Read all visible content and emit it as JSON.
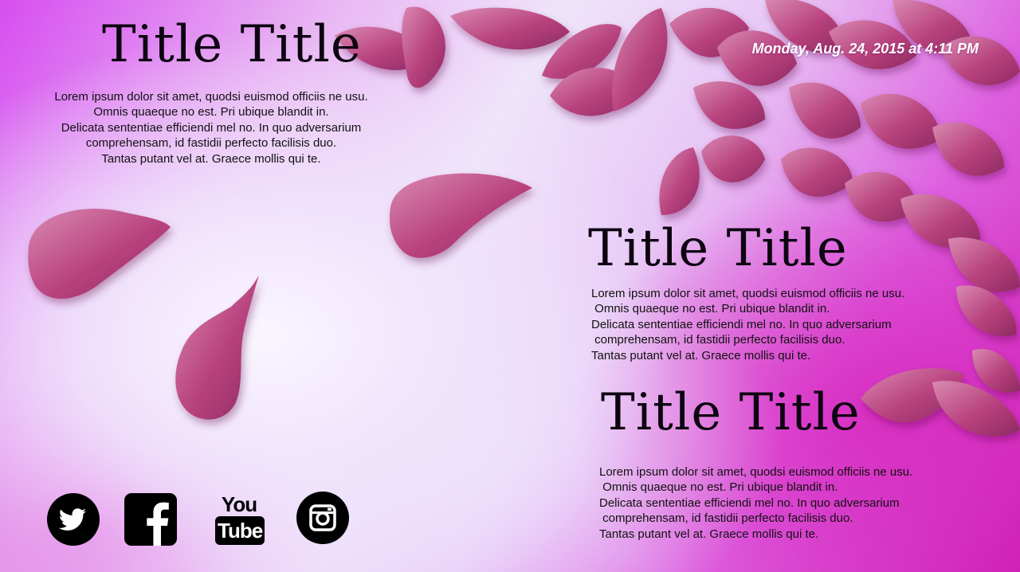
{
  "header": {
    "datetime": "Monday, Aug. 24, 2015 at 4:11 PM"
  },
  "sections": [
    {
      "title": "Title Title",
      "lines": [
        "Lorem ipsum dolor sit amet, quodsi euismod officiis ne usu.",
        "Omnis quaeque no est. Pri ubique blandit in.",
        "Delicata sententiae efficiendi mel no. In quo adversarium",
        "comprehensam, id fastidii perfecto facilisis duo.",
        "Tantas putant vel at. Graece mollis qui te."
      ]
    },
    {
      "title": "Title Title",
      "lines": [
        "Lorem ipsum dolor sit amet, quodsi euismod officiis ne usu.",
        " Omnis quaeque no est. Pri ubique blandit in.",
        "Delicata sententiae efficiendi mel no. In quo adversarium",
        " comprehensam, id fastidii perfecto facilisis duo.",
        "Tantas putant vel at. Graece mollis qui te."
      ]
    },
    {
      "title": "Title Title",
      "lines": [
        "Lorem ipsum dolor sit amet, quodsi euismod officiis ne usu.",
        " Omnis quaeque no est. Pri ubique blandit in.",
        "Delicata sententiae efficiendi mel no. In quo adversarium",
        " comprehensam, id fastidii perfecto facilisis duo.",
        "Tantas putant vel at. Graece mollis qui te."
      ]
    }
  ],
  "social": {
    "youtube_top": "You",
    "youtube_bottom": "Tube",
    "icons": [
      "twitter-icon",
      "facebook-icon",
      "youtube-icon",
      "instagram-icon"
    ]
  },
  "colors": {
    "petal": "#b8427e",
    "petal_light": "#d98ab2",
    "accent_magenta": "#cf1fb4",
    "text": "#111111",
    "date_text": "#ffffff"
  }
}
